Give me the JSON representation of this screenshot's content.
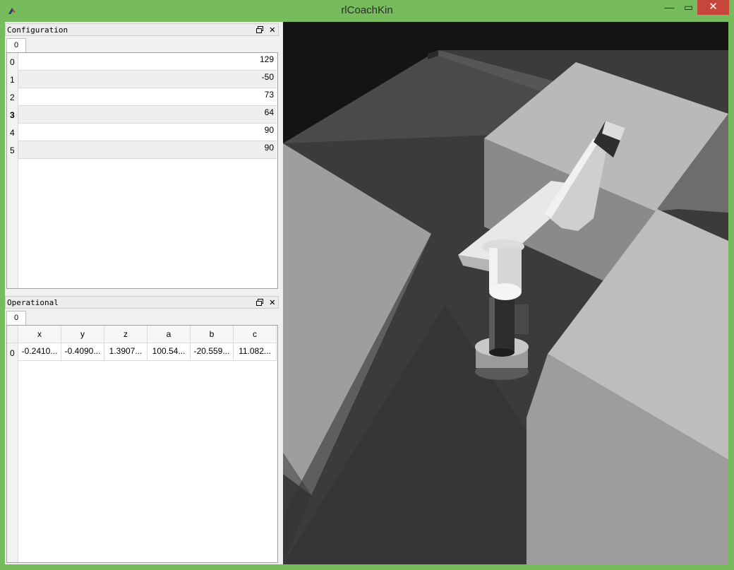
{
  "window": {
    "title": "rlCoachKin",
    "minimize_label": "—",
    "maximize_label": "▭",
    "close_label": "✕"
  },
  "configuration": {
    "title": "Configuration",
    "tab": "0",
    "rows": [
      {
        "index": "0",
        "value": "129"
      },
      {
        "index": "1",
        "value": "-50"
      },
      {
        "index": "2",
        "value": "73"
      },
      {
        "index": "3",
        "value": "64"
      },
      {
        "index": "4",
        "value": "90"
      },
      {
        "index": "5",
        "value": "90"
      }
    ]
  },
  "operational": {
    "title": "Operational",
    "tab": "0",
    "columns": [
      "x",
      "y",
      "z",
      "a",
      "b",
      "c"
    ],
    "rows": [
      {
        "index": "0",
        "cells": [
          "-0.2410...",
          "-0.4090...",
          "1.3907...",
          "100.54...",
          "-20.559...",
          "11.082..."
        ]
      }
    ]
  },
  "colors": {
    "frame": "#76bb5c",
    "close_button": "#c7463c",
    "scene_floor": "#3a3a3a",
    "scene_box": "#c8c8c8"
  },
  "icons": [
    "app-icon",
    "float-icon",
    "close-icon"
  ]
}
